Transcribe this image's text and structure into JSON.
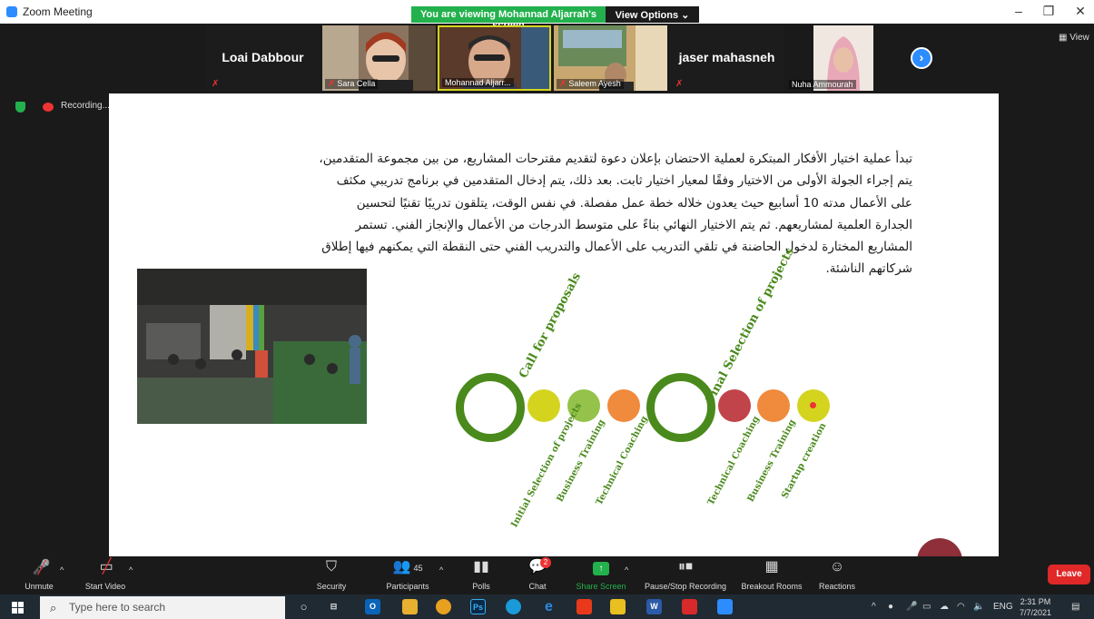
{
  "window": {
    "title": "Zoom Meeting",
    "app_icon": "zoom-logo-icon"
  },
  "banner": {
    "viewing_text": "You are viewing Mohannad Aljarrah's screen",
    "view_options": "View Options ⌄",
    "color": "#23b14d"
  },
  "window_controls": {
    "minimize": "–",
    "restore": "❐",
    "close": "✕"
  },
  "participants_strip": {
    "tiles": [
      {
        "name": "Loai Dabbour",
        "video": false,
        "muted": true
      },
      {
        "name": "Sara Cella",
        "video": true,
        "muted": true
      },
      {
        "name": "Mohannad Aljarr...",
        "video": true,
        "muted": false
      },
      {
        "name": "Saleem Ayesh",
        "video": true,
        "muted": true
      },
      {
        "name": "jaser mahasneh",
        "video": false,
        "muted": true
      },
      {
        "name": "Nuha Ammourah",
        "video": true,
        "muted": false
      }
    ],
    "next_icon": "chevron-right-icon",
    "view_label": "View"
  },
  "recording": {
    "label": "Recording...",
    "pause_icon": "pause-icon",
    "stop_icon": "stop-icon"
  },
  "slide": {
    "paragraph": "تبدأ عملية اختيار الأفكار المبتكرة لعملية الاحتضان بإعلان دعوة لتقديم مقترحات المشاريع، من بين مجموعة المتقدمين، يتم إجراء الجولة الأولى من الاختيار وفقًا لمعيار اختيار ثابت. بعد ذلك، يتم إدخال المتقدمين في برنامج تدريبي مكثف على الأعمال مدته 10 أسابيع حيث يعدون خلاله خطة عمل مفصلة. في نفس الوقت، يتلقون تدريبًا تقنيًا لتحسين الجدارة العلمية لمشاريعهم. ثم يتم الاختيار النهائي بناءً على متوسط الدرجات من الأعمال والإنجاز الفني. تستمر المشاريع المختارة لدخول الحاضنة في تلقي التدريب على الأعمال والتدريب الفني حتى النقطة التي يمكنهم فيها إطلاق شركاتهم الناشئة.",
    "diagram": {
      "top_labels": [
        "Call for proposals",
        "Final Selection of projects"
      ],
      "bottom_labels": [
        "Initial Selection of projects",
        "Business Training",
        "Technical Coaching",
        "Technical Coaching",
        "Business Training",
        "Startup creation"
      ],
      "colors": {
        "ring": "#4a8a1c",
        "yellow": "#d4d41f",
        "green": "#94c24a",
        "orange": "#f08a3c",
        "red": "#c0444a"
      }
    }
  },
  "toolbar": {
    "unmute": "Unmute",
    "start_video": "Start Video",
    "security": "Security",
    "participants": "Participants",
    "participants_count": "45",
    "polls": "Polls",
    "chat": "Chat",
    "chat_badge": "2",
    "share_screen": "Share Screen",
    "pause_stop_recording": "Pause/Stop Recording",
    "breakout_rooms": "Breakout Rooms",
    "reactions": "Reactions",
    "leave": "Leave"
  },
  "taskbar": {
    "search_placeholder": "Type here to search",
    "apps": [
      "cortana-icon",
      "task-view-icon",
      "outlook-icon",
      "file-explorer-icon",
      "chrome-icon",
      "photoshop-icon",
      "edge-icon",
      "internet-explorer-icon",
      "office-icon",
      "color-app-icon",
      "word-icon",
      "acrobat-icon",
      "zoom-icon"
    ],
    "tray_lang": "ENG",
    "time": "2:31 PM",
    "date": "7/7/2021"
  }
}
